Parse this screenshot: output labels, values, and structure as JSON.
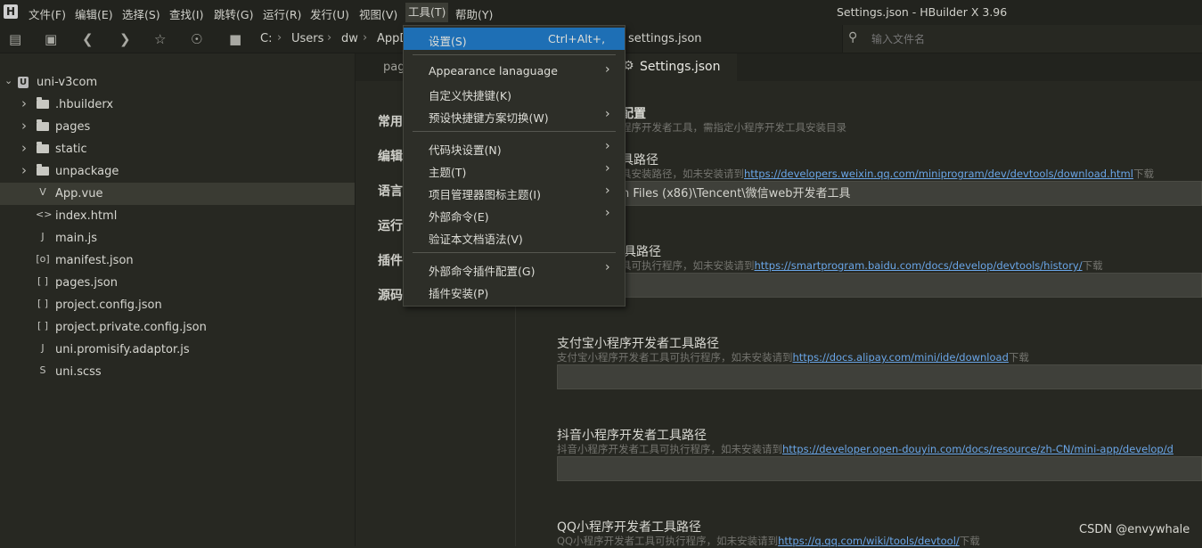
{
  "menubar": {
    "items": [
      "文件(F)",
      "编辑(E)",
      "选择(S)",
      "查找(I)",
      "跳转(G)",
      "运行(R)",
      "发行(U)",
      "视图(V)",
      "工具(T)",
      "帮助(Y)"
    ],
    "window_title": "Settings.json - HBuilder X 3.96"
  },
  "toolbar": {
    "breadcrumb": [
      "C:",
      "Users",
      "dw",
      "AppD",
      "settings.json"
    ],
    "search_placeholder": "输入文件名"
  },
  "sidebar": {
    "root": "uni-v3com",
    "items": [
      {
        "label": ".hbuilderx",
        "type": "folder"
      },
      {
        "label": "pages",
        "type": "folder"
      },
      {
        "label": "static",
        "type": "folder"
      },
      {
        "label": "unpackage",
        "type": "folder"
      },
      {
        "label": "App.vue",
        "type": "vue",
        "selected": true
      },
      {
        "label": "index.html",
        "type": "html"
      },
      {
        "label": "main.js",
        "type": "js"
      },
      {
        "label": "manifest.json",
        "type": "manifest"
      },
      {
        "label": "pages.json",
        "type": "json"
      },
      {
        "label": "project.config.json",
        "type": "json"
      },
      {
        "label": "project.private.config.json",
        "type": "json"
      },
      {
        "label": "uni.promisify.adaptor.js",
        "type": "js"
      },
      {
        "label": "uni.scss",
        "type": "scss"
      }
    ],
    "icon_glyphs": {
      "vue": "V",
      "html": "<>",
      "js": "J",
      "manifest": "[o]",
      "json": "[ ]",
      "scss": "S"
    }
  },
  "tabs": [
    {
      "label": "pag"
    },
    {
      "label": "Settings.json",
      "active": true
    }
  ],
  "settings_nav": [
    "常用",
    "编辑",
    "语言",
    "运行",
    "插件",
    "源码"
  ],
  "settings": {
    "header_title": "配置",
    "header_desc": "程序开发者工具，需指定小程序开发工具安装目录",
    "sections": [
      {
        "title": "具路径",
        "desc_prefix": "具安装路径，如未安装请到",
        "link": "https://developers.weixin.qq.com/miniprogram/dev/devtools/download.html",
        "desc_suffix": "下载",
        "value": "n Files (x86)\\Tencent\\微信web开发者工具"
      },
      {
        "title": "工具路径",
        "desc_prefix": "具可执行程序，如未安装请到",
        "link": "https://smartprogram.baidu.com/docs/develop/devtools/history/",
        "desc_suffix": "下载",
        "value": ""
      },
      {
        "title": "支付宝小程序开发者工具路径",
        "desc_prefix": "支付宝小程序开发者工具可执行程序，如未安装请到",
        "link": "https://docs.alipay.com/mini/ide/download",
        "desc_suffix": "下载",
        "value": ""
      },
      {
        "title": "抖音小程序开发者工具路径",
        "desc_prefix": "抖音小程序开发者工具可执行程序，如未安装请到",
        "link": "https://developer.open-douyin.com/docs/resource/zh-CN/mini-app/develop/d",
        "desc_suffix": "",
        "value": ""
      },
      {
        "title": "QQ小程序开发者工具路径",
        "desc_prefix": "QQ小程序开发者工具可执行程序，如未安装请到",
        "link": "https://q.qq.com/wiki/tools/devtool/",
        "desc_suffix": "下载",
        "value": ""
      }
    ]
  },
  "tools_menu": {
    "items": [
      {
        "label": "设置(S)",
        "shortcut": "Ctrl+Alt+,",
        "highlighted": true
      },
      {
        "separator": true
      },
      {
        "label": "Appearance lanaguage",
        "submenu": true
      },
      {
        "label": "自定义快捷键(K)"
      },
      {
        "label": "预设快捷键方案切换(W)",
        "submenu": true
      },
      {
        "separator": true
      },
      {
        "label": "代码块设置(N)",
        "submenu": true
      },
      {
        "label": "主题(T)",
        "submenu": true
      },
      {
        "label": "项目管理器图标主题(I)",
        "submenu": true
      },
      {
        "label": "外部命令(E)",
        "submenu": true
      },
      {
        "label": "验证本文档语法(V)"
      },
      {
        "separator": true
      },
      {
        "label": "外部命令插件配置(G)",
        "submenu": true
      },
      {
        "label": "插件安装(P)"
      }
    ]
  },
  "watermark": "CSDN @envywhale",
  "colors": {
    "background": "#272822",
    "menu_highlight": "#1e6fb5",
    "link": "#6aa6e8"
  }
}
